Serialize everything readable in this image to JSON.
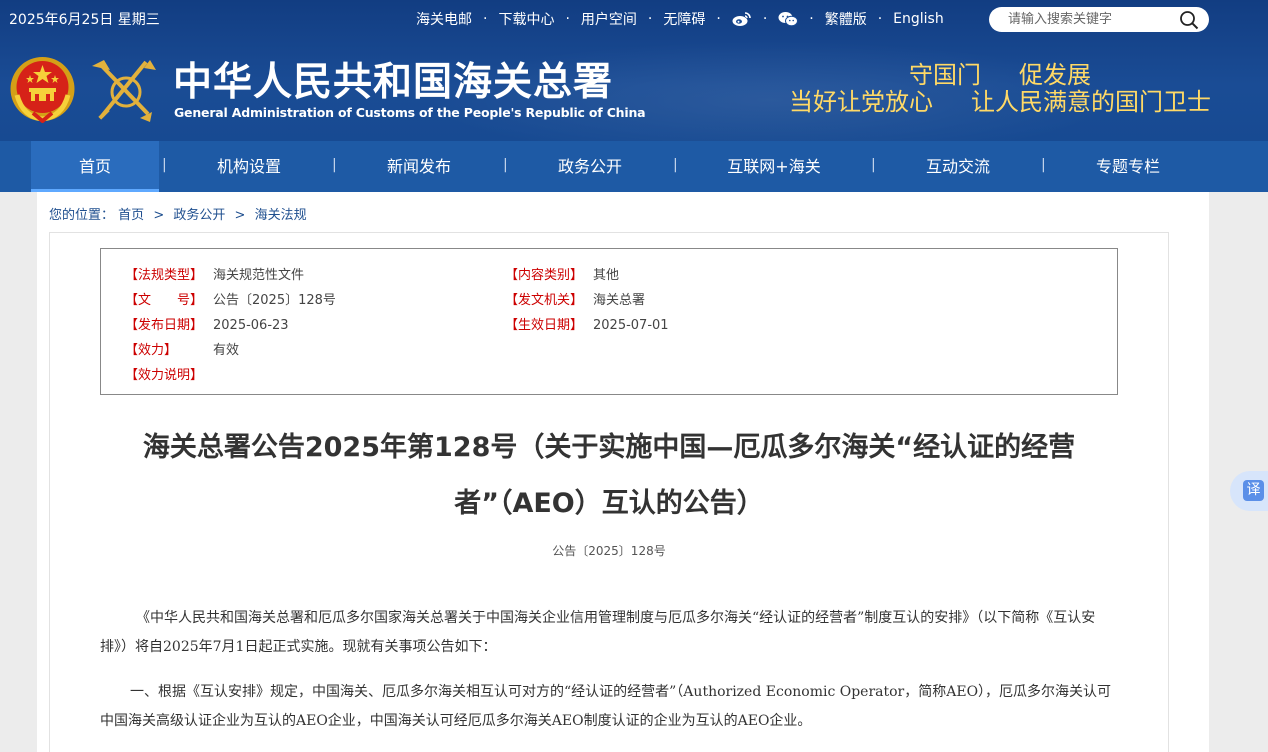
{
  "header": {
    "date": "2025年6月25日 星期三",
    "links": [
      "海关电邮",
      "下载中心",
      "用户空间",
      "无障碍"
    ],
    "links2": [
      "繁體版",
      "English"
    ],
    "search_placeholder": "请输入搜索关键字",
    "title_cn": "中华人民共和国海关总署",
    "title_en": "General Administration of Customs of the People's Republic of China",
    "slogan_line1": [
      "守国门",
      "促发展"
    ],
    "slogan_line2": [
      "当好让党放心",
      "让人民满意的国门卫士"
    ],
    "icons": [
      "weibo-icon",
      "wechat-icon",
      "search-icon",
      "national-emblem",
      "customs-emblem"
    ]
  },
  "nav": {
    "items": [
      "首页",
      "机构设置",
      "新闻发布",
      "政务公开",
      "互联网+海关",
      "互动交流",
      "专题专栏"
    ],
    "active": "首页",
    "separator": "|"
  },
  "breadcrumb": {
    "prefix": "您的位置：",
    "items": [
      "首页",
      "政务公开",
      "海关法规"
    ],
    "separator": ">"
  },
  "meta": {
    "type_label": "【法规类型】",
    "type_value": "海关规范性文件",
    "category_label": "【内容类别】",
    "category_value": "其他",
    "docno_label": "【文　　号】",
    "docno_value": "公告〔2025〕128号",
    "issuer_label": "【发文机关】",
    "issuer_value": "海关总署",
    "pubdate_label": "【发布日期】",
    "pubdate_value": "2025-06-23",
    "effdate_label": "【生效日期】",
    "effdate_value": "2025-07-01",
    "validity_label": "【效力】",
    "validity_value": "有效",
    "validity_note_label": "【效力说明】"
  },
  "article": {
    "title": "海关总署公告2025年第128号（关于实施中国—厄瓜多尔海关“经认证的经营者”（AEO）互认的公告）",
    "doc_no": "公告〔2025〕128号",
    "p1": "《中华人民共和国海关总署和厄瓜多尔国家海关总署关于中国海关企业信用管理制度与厄瓜多尔海关“经认证的经营者”制度互认的安排》（以下简称《互认安排》）将自2025年7月1日起正式实施。现就有关事项公告如下：",
    "p2": "一、根据《互认安排》规定，中国海关、厄瓜多尔海关相互认可对方的“经认证的经营者”（Authorized Economic Operator，简称AEO），厄瓜多尔海关认可中国海关高级认证企业为互认的AEO企业，中国海关认可经厄瓜多尔海关AEO制度认证的企业为互认的AEO企业。"
  },
  "translate_button": "译",
  "colors": {
    "header_bg": "#1a4c95",
    "nav_bg": "#1e5aa5",
    "slogan": "#ffd966",
    "meta_label": "#cc0000"
  }
}
